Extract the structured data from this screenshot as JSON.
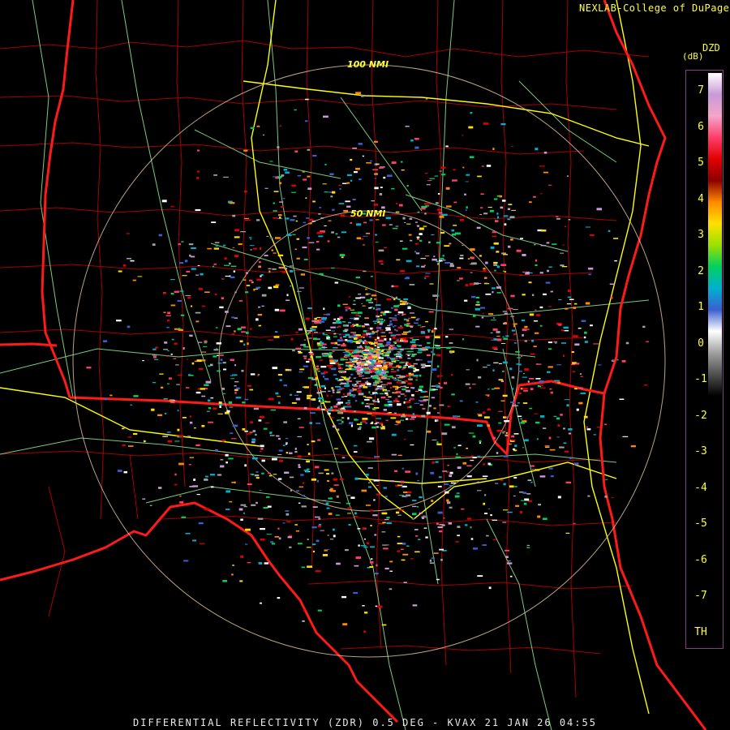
{
  "credit": "NEXLAB-College of DuPage",
  "product_code": "DZD",
  "unit": "(dB)",
  "range_rings": [
    "100 NMI",
    "50 NMI"
  ],
  "colorbar": {
    "ticks": [
      "7",
      "6",
      "5",
      "4",
      "3",
      "2",
      "1",
      "0",
      "-1",
      "-2",
      "-3",
      "-4",
      "-5",
      "-6",
      "-7",
      "TH"
    ],
    "stops": [
      "#ffffff",
      "#c89ad8",
      "#f3a6c8",
      "#ff3d6b",
      "#e10000",
      "#8b0000",
      "#ff8a00",
      "#ffe000",
      "#9be000",
      "#00d060",
      "#00b0d0",
      "#3a60d0",
      "#ffffff",
      "#a0a0a0",
      "#505050",
      "#000000"
    ]
  },
  "colors": {
    "state_border": "#ff1a1a",
    "county": "#b00000",
    "highway": "#ffff00",
    "road": "#90ee90",
    "ring": "#e8c9a0"
  },
  "footer": "DIFFERENTIAL REFLECTIVITY (ZDR) 0.5 DEG - KVAX 21 JAN 26 04:55"
}
